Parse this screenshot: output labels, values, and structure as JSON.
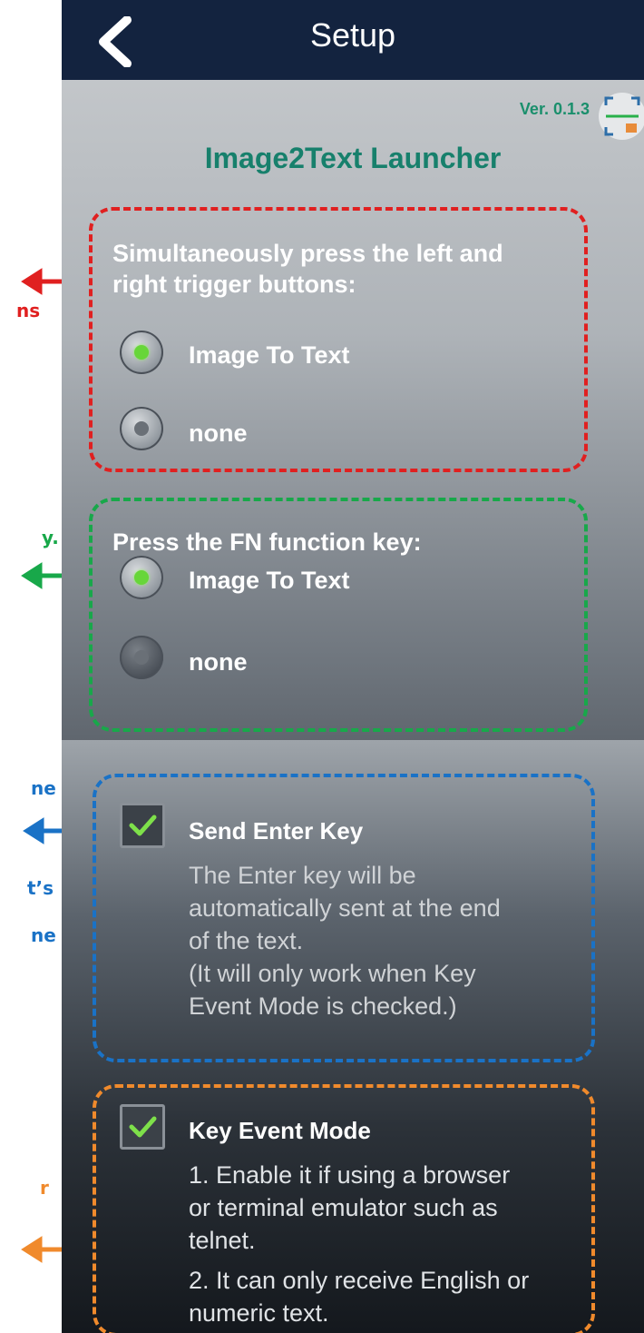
{
  "annotations": {
    "red_fragment": "ns",
    "green_fragment": "y.",
    "blue_fragment_1": "ne",
    "blue_fragment_2": "t’s",
    "blue_fragment_3": "ne",
    "orange_fragment": "r"
  },
  "appbar": {
    "title": "Setup",
    "back_icon": "chevron-left-icon"
  },
  "header": {
    "version": "Ver. 0.1.3",
    "app_name": "Image2Text Launcher",
    "scan_icon": "scan-text-icon"
  },
  "trigger_section": {
    "label_line1": "Simultaneously press the left and",
    "label_line2": "right trigger buttons:",
    "options": [
      {
        "label": "Image To Text",
        "selected": true
      },
      {
        "label": "none",
        "selected": false
      }
    ]
  },
  "fn_section": {
    "label": "Press the FN function key:",
    "options": [
      {
        "label": "Image To Text",
        "selected": true
      },
      {
        "label": "none",
        "selected": false
      }
    ]
  },
  "send_enter": {
    "title": "Send Enter Key",
    "checked": true,
    "desc_lines": [
      "The Enter key will be",
      "automatically sent at the end",
      "of the text.",
      "(It will only work when Key",
      "Event Mode is checked.)"
    ]
  },
  "key_event": {
    "title": "Key Event Mode",
    "checked": true,
    "desc1_lines": [
      "1. Enable it if using a browser",
      "or terminal emulator such as",
      "telnet."
    ],
    "desc2_lines": [
      "2. It can only receive English or",
      "numeric text."
    ]
  },
  "colors": {
    "appbar": "#13233f",
    "accent_teal": "#17806c",
    "radio_on": "#67d639",
    "annotation_red": "#e02020",
    "annotation_green": "#18a84a",
    "annotation_blue": "#1a72c6",
    "annotation_orange": "#f08a2c"
  }
}
